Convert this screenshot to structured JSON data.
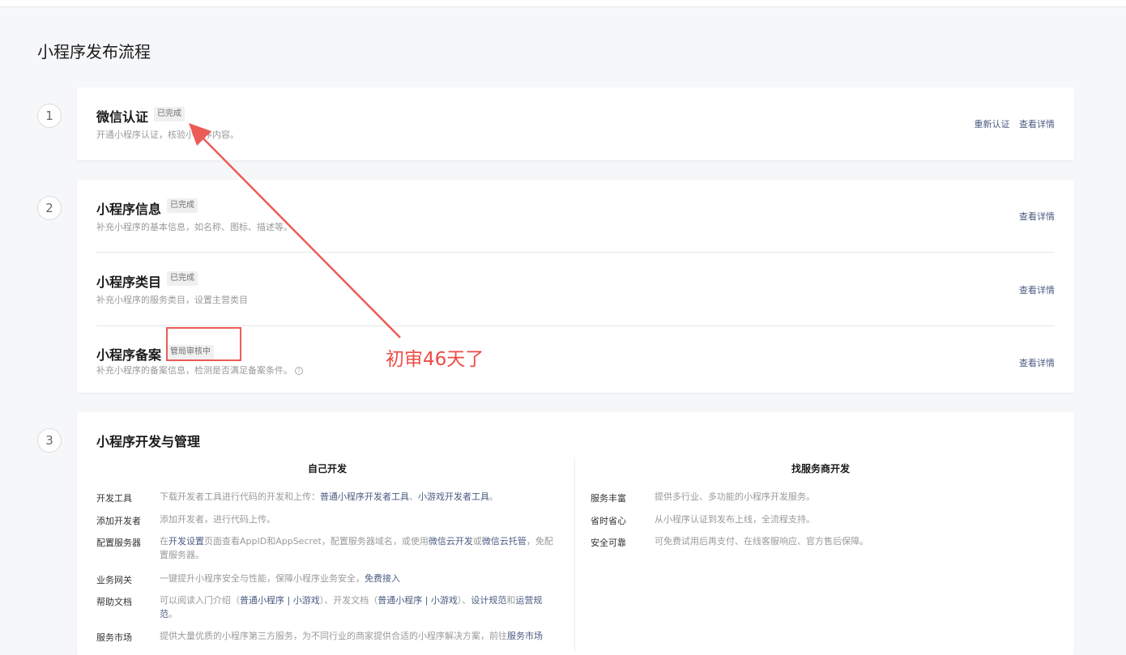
{
  "page": {
    "title": "小程序发布流程"
  },
  "steps": [
    "1",
    "2",
    "3"
  ],
  "step1": {
    "title": "微信认证",
    "badge": "已完成",
    "desc": "开通小程序认证，核验小程序内容。",
    "link_recert": "重新认证",
    "link_detail": "查看详情"
  },
  "step2": {
    "items": [
      {
        "title": "小程序信息",
        "badge": "已完成",
        "desc": "补充小程序的基本信息，如名称、图标、描述等。",
        "link": "查看详情"
      },
      {
        "title": "小程序类目",
        "badge": "已完成",
        "desc": "补充小程序的服务类目，设置主营类目",
        "link": "查看详情"
      },
      {
        "title": "小程序备案",
        "badge": "管局审核中",
        "desc": "补充小程序的备案信息，检测是否满足备案条件。",
        "link": "查看详情",
        "help_glyph": "?"
      }
    ]
  },
  "step3": {
    "title": "小程序开发与管理",
    "self": {
      "heading": "自己开发",
      "rows": [
        {
          "label": "开发工具",
          "text1": "下载开发者工具进行代码的开发和上传：",
          "link1": "普通小程序开发者工具",
          "sep1": "、",
          "link2": "小游戏开发者工具",
          "end": "。"
        },
        {
          "label": "添加开发者",
          "text1": "添加开发者，进行代码上传。"
        },
        {
          "label": "配置服务器",
          "text1": "在",
          "link1": "开发设置",
          "text2": "页面查看AppID和AppSecret，配置服务器域名，或使用",
          "link2": "微信云开发",
          "text3": "或",
          "link3": "微信云托管",
          "text4": "，免配置服务器。"
        },
        {
          "label": "业务网关",
          "text1": "一键提升小程序安全与性能，保障小程序业务安全，",
          "link1": "免费接入"
        },
        {
          "label": "帮助文档",
          "text1": "可以阅读入门介绍（",
          "link1": "普通小程序",
          "sep1": " | ",
          "link2": "小游戏",
          "text2": "）、开发文档（",
          "link3": "普通小程序",
          "sep2": " | ",
          "link4": "小游戏",
          "text3": "）、",
          "link5": "设计规范",
          "text4": "和",
          "link6": "运营规范",
          "end": "。"
        },
        {
          "label": "服务市场",
          "text1": "提供大量优质的小程序第三方服务，为不同行业的商家提供合适的小程序解决方案，前往",
          "link1": "服务市场"
        }
      ]
    },
    "provider": {
      "heading": "找服务商开发",
      "rows": [
        {
          "label": "服务丰富",
          "text": "提供多行业、多功能的小程序开发服务。"
        },
        {
          "label": "省时省心",
          "text": "从小程序认证到发布上线，全流程支持。"
        },
        {
          "label": "安全可靠",
          "text": "可免费试用后再支付、在线客服响应、官方售后保障。"
        }
      ]
    }
  },
  "annotation": {
    "text": "初审46天了",
    "color": "#ec4c47"
  }
}
